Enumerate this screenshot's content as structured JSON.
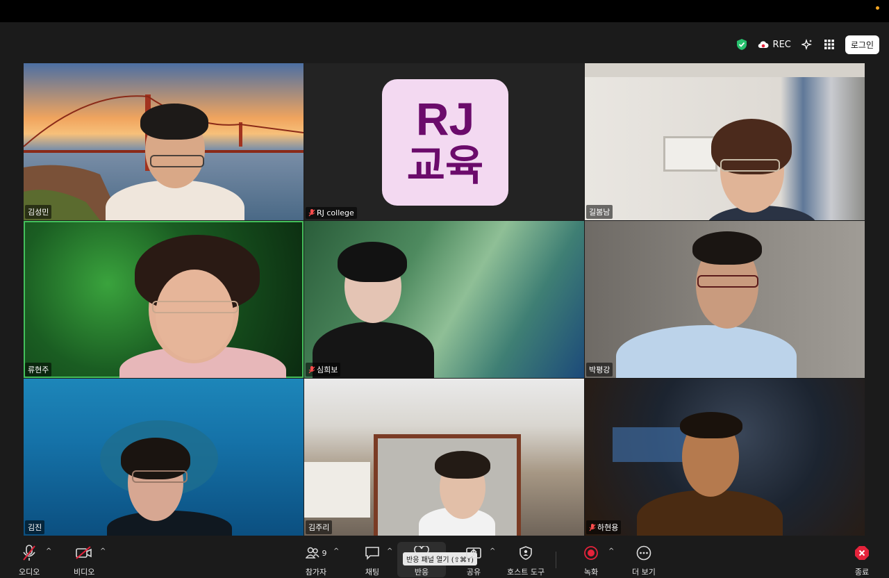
{
  "status": {
    "rec_label": "REC",
    "login_label": "로그인"
  },
  "tiles": [
    {
      "name": "김성민",
      "muted": false
    },
    {
      "name": "RJ college",
      "muted": true,
      "logo_line1": "RJ",
      "logo_line2": "교육"
    },
    {
      "name": "길봄남",
      "muted": false
    },
    {
      "name": "류현주",
      "muted": false,
      "active_speaker": true
    },
    {
      "name": "심희보",
      "muted": true
    },
    {
      "name": "박평강",
      "muted": false
    },
    {
      "name": "김진",
      "muted": false
    },
    {
      "name": "김주리",
      "muted": false
    },
    {
      "name": "하현용",
      "muted": true
    }
  ],
  "toolbar": {
    "audio_label": "오디오",
    "video_label": "비디오",
    "participants_label": "참가자",
    "participants_count": "9",
    "chat_label": "채팅",
    "reactions_label": "반응",
    "reactions_tooltip": "반응 패널 열기 (⇧⌘Y)",
    "share_label": "공유",
    "host_tools_label": "호스트 도구",
    "record_label": "녹화",
    "more_label": "더 보기",
    "end_label": "종료"
  },
  "colors": {
    "active_speaker": "#44c05b",
    "record": "#e5233b",
    "end": "#e5233b",
    "logo_bg": "#f3d9f1",
    "logo_text": "#6b0b6b"
  }
}
